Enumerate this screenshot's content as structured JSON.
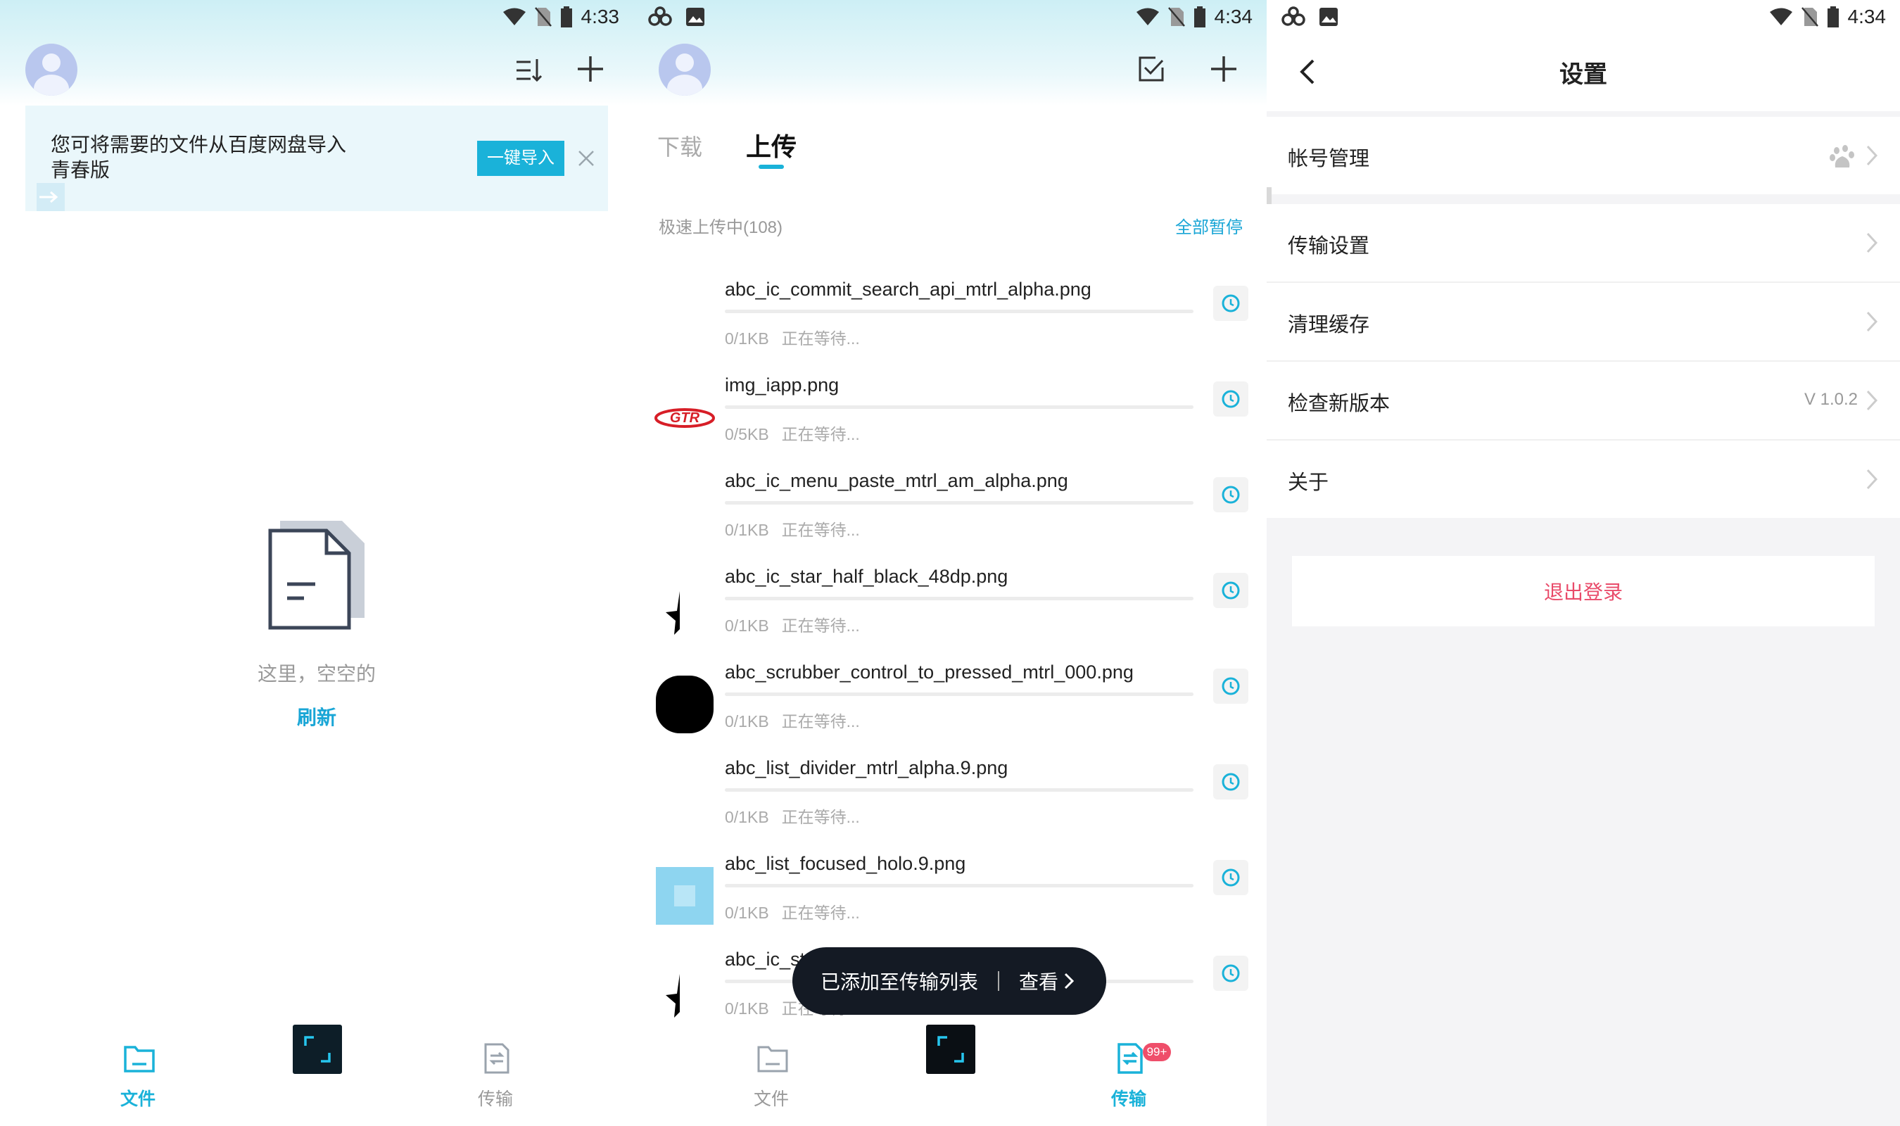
{
  "panel_files": {
    "status_time": "4:33",
    "banner": {
      "text": "您可将需要的文件从百度网盘导入青春版",
      "import_button": "一键导入"
    },
    "empty_text": "这里，空空的",
    "refresh_label": "刷新",
    "nav": {
      "files": "文件",
      "transfer": "传输"
    }
  },
  "panel_transfer": {
    "status_time": "4:34",
    "tabs": [
      "下载",
      "上传"
    ],
    "active_tab": "上传",
    "section_label": "极速上传中(108)",
    "pause_all": "全部暂停",
    "items": [
      {
        "name": "abc_ic_commit_search_api_mtrl_alpha.png",
        "size": "0/1KB",
        "status": "正在等待...",
        "thumb": "none"
      },
      {
        "name": "img_iapp.png",
        "size": "0/5KB",
        "status": "正在等待...",
        "thumb": "gtr-logo"
      },
      {
        "name": "abc_ic_menu_paste_mtrl_am_alpha.png",
        "size": "0/1KB",
        "status": "正在等待...",
        "thumb": "none"
      },
      {
        "name": "abc_ic_star_half_black_48dp.png",
        "size": "0/1KB",
        "status": "正在等待...",
        "thumb": "half-star"
      },
      {
        "name": "abc_scrubber_control_to_pressed_mtrl_000.png",
        "size": "0/1KB",
        "status": "正在等待...",
        "thumb": "black-circle"
      },
      {
        "name": "abc_list_divider_mtrl_alpha.9.png",
        "size": "0/1KB",
        "status": "正在等待...",
        "thumb": "none"
      },
      {
        "name": "abc_list_focused_holo.9.png",
        "size": "0/1KB",
        "status": "正在等待...",
        "thumb": "blue-square"
      },
      {
        "name": "abc_ic_star_half_black_16dp.png",
        "size": "0/1KB",
        "status": "正在等待...",
        "thumb": "half-star"
      }
    ],
    "toast": {
      "message": "已添加至传输列表",
      "action": "查看"
    },
    "nav": {
      "files": "文件",
      "transfer": "传输",
      "badge": "99+"
    }
  },
  "panel_settings": {
    "status_time": "4:34",
    "title": "设置",
    "rows": [
      {
        "label": "帐号管理",
        "value": ""
      },
      {
        "label": "传输设置",
        "value": ""
      },
      {
        "label": "清理缓存",
        "value": ""
      },
      {
        "label": "检查新版本",
        "value": "V 1.0.2"
      },
      {
        "label": "关于",
        "value": ""
      }
    ],
    "logout": "退出登录"
  },
  "colors": {
    "accent": "#1ab2d9",
    "danger": "#e94b6a",
    "badge": "#ef4e6a",
    "toast_bg": "#141a24"
  },
  "icons": {
    "status": [
      "wifi-icon",
      "no-sim-icon",
      "battery-icon"
    ],
    "header_files": [
      "sort-icon",
      "add-icon"
    ],
    "header_transfer": [
      "multi-select-icon",
      "add-icon"
    ],
    "settings": [
      "back-icon",
      "baidu-paw-icon",
      "chevron-right-icon"
    ]
  }
}
